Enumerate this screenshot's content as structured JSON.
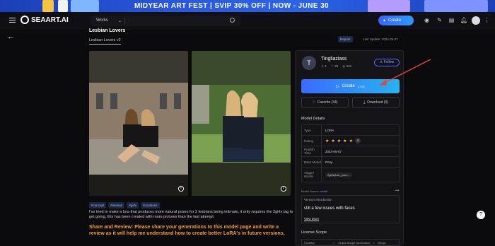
{
  "banner": {
    "text": "MIDYEAR ART FEST | SVIP 30% OFF | NOW - JUNE 30"
  },
  "header": {
    "logo": "SEAART.AI",
    "search_category": "Works",
    "create_label": "Create"
  },
  "model": {
    "title": "Lesbian Lovers",
    "version_tab": "Lesbian Lovers v2",
    "reprint": "Reprint",
    "last_update": "Last Update: 2024-05-07",
    "tags": [
      "#concept",
      "#woman",
      "#girls",
      "#Lesbians"
    ],
    "description": "I've tried to make a lora that produces more natural poses for 2 lesbians being intimate, it only requires the 2girls tag to get going, this has been created with more pictures than the last attempt.",
    "share": "Share and Review: Please share your generations to this model page and write a review as it will help me understand how to create better LoRA's in future versions."
  },
  "author": {
    "avatar_letter": "T",
    "name": "Tingliaziass",
    "stats": [
      "1",
      "36",
      "348"
    ],
    "follow": "Follow"
  },
  "actions": {
    "create": "Create",
    "create_cost": "5.480",
    "favorite": "Favorite (34)",
    "download": "Download (0)"
  },
  "details": {
    "heading": "Model Details",
    "rows": [
      {
        "k": "Type",
        "v": "LORA"
      },
      {
        "k": "Rating",
        "v": "4"
      },
      {
        "k": "Publish Time",
        "v": "2024-05-07"
      },
      {
        "k": "Base Model",
        "v": "Pony"
      },
      {
        "k": "Trigger Words",
        "v": "2girls|lora_prom..."
      }
    ],
    "source_label": "Model Source:",
    "source_value": "civitai",
    "version_intro_label": "Version Introduction",
    "version_intro": "still a few issues with faces",
    "view_more": "View More",
    "license_heading": "License Scope",
    "license_row": "Creative",
    "license_items": [
      "Online Image Generation",
      "Merge"
    ]
  },
  "colors": {
    "accent": "#3a6bff",
    "arrow": "#e8453c",
    "share": "#f29d2a"
  }
}
